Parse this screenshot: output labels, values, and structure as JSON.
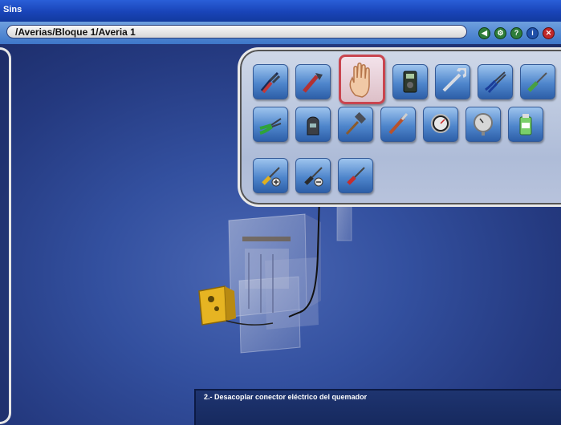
{
  "window": {
    "title": "Sins"
  },
  "path": {
    "value": "/Averias/Bloque 1/Averia 1"
  },
  "window_buttons": [
    {
      "icon": "back-icon",
      "color": "#2e7d3a"
    },
    {
      "icon": "settings-icon",
      "color": "#2e7d3a"
    },
    {
      "icon": "help-icon",
      "color": "#2e7d3a"
    },
    {
      "icon": "info-icon",
      "color": "#1f4fa8"
    },
    {
      "icon": "close-icon",
      "color": "#c0282a"
    }
  ],
  "toolbox": {
    "tools": [
      {
        "icon": "pliers-icon"
      },
      {
        "icon": "pipe-wrench-icon"
      },
      {
        "icon": "hand-icon",
        "selected": true
      },
      {
        "icon": "multimeter-icon"
      },
      {
        "icon": "open-wrench-icon"
      },
      {
        "icon": "long-nose-pliers-icon"
      },
      {
        "icon": "screwdriver-icon"
      },
      {
        "icon": "wire-cutters-icon"
      },
      {
        "icon": "clamp-meter-icon"
      },
      {
        "icon": "hammer-icon"
      },
      {
        "icon": "brush-icon"
      },
      {
        "icon": "pressure-gauge-icon"
      },
      {
        "icon": "manometer-icon"
      },
      {
        "icon": "spray-can-icon"
      },
      {
        "icon": "phillips-screwdriver-icon"
      },
      {
        "icon": "flat-screwdriver-icon"
      },
      {
        "icon": "red-screwdriver-icon"
      }
    ]
  },
  "message": {
    "text": "2.- Desacoplar conector eléctrico del quemador"
  }
}
